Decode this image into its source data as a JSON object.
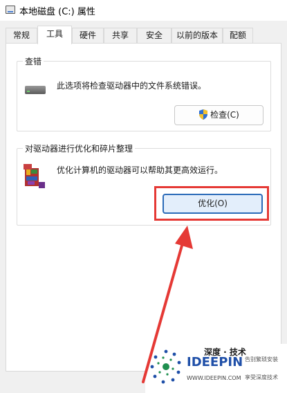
{
  "window": {
    "title": "本地磁盘 (C:) 属性"
  },
  "tabs": [
    {
      "label": "常规"
    },
    {
      "label": "工具"
    },
    {
      "label": "硬件"
    },
    {
      "label": "共享"
    },
    {
      "label": "安全"
    },
    {
      "label": "以前的版本"
    },
    {
      "label": "配额"
    }
  ],
  "active_tab": "工具",
  "error_check": {
    "title": "查错",
    "description": "此选项将检查驱动器中的文件系统错误。",
    "button_label": "检查(C)"
  },
  "optimize": {
    "title": "对驱动器进行优化和碎片整理",
    "description": "优化计算机的驱动器可以帮助其更高效运行。",
    "button_label": "优化(O)"
  },
  "watermark": {
    "brand_cn": "深度 · 技术",
    "brand_en": "IDEEPIN",
    "url": "WWW.IDEEPIN.COM",
    "slogan1": "告别繁琐安装",
    "slogan2": "享受深度技术"
  },
  "colors": {
    "highlight": "#e53935",
    "brand_blue": "#1f4fa8",
    "brand_green": "#1f8f4f"
  }
}
